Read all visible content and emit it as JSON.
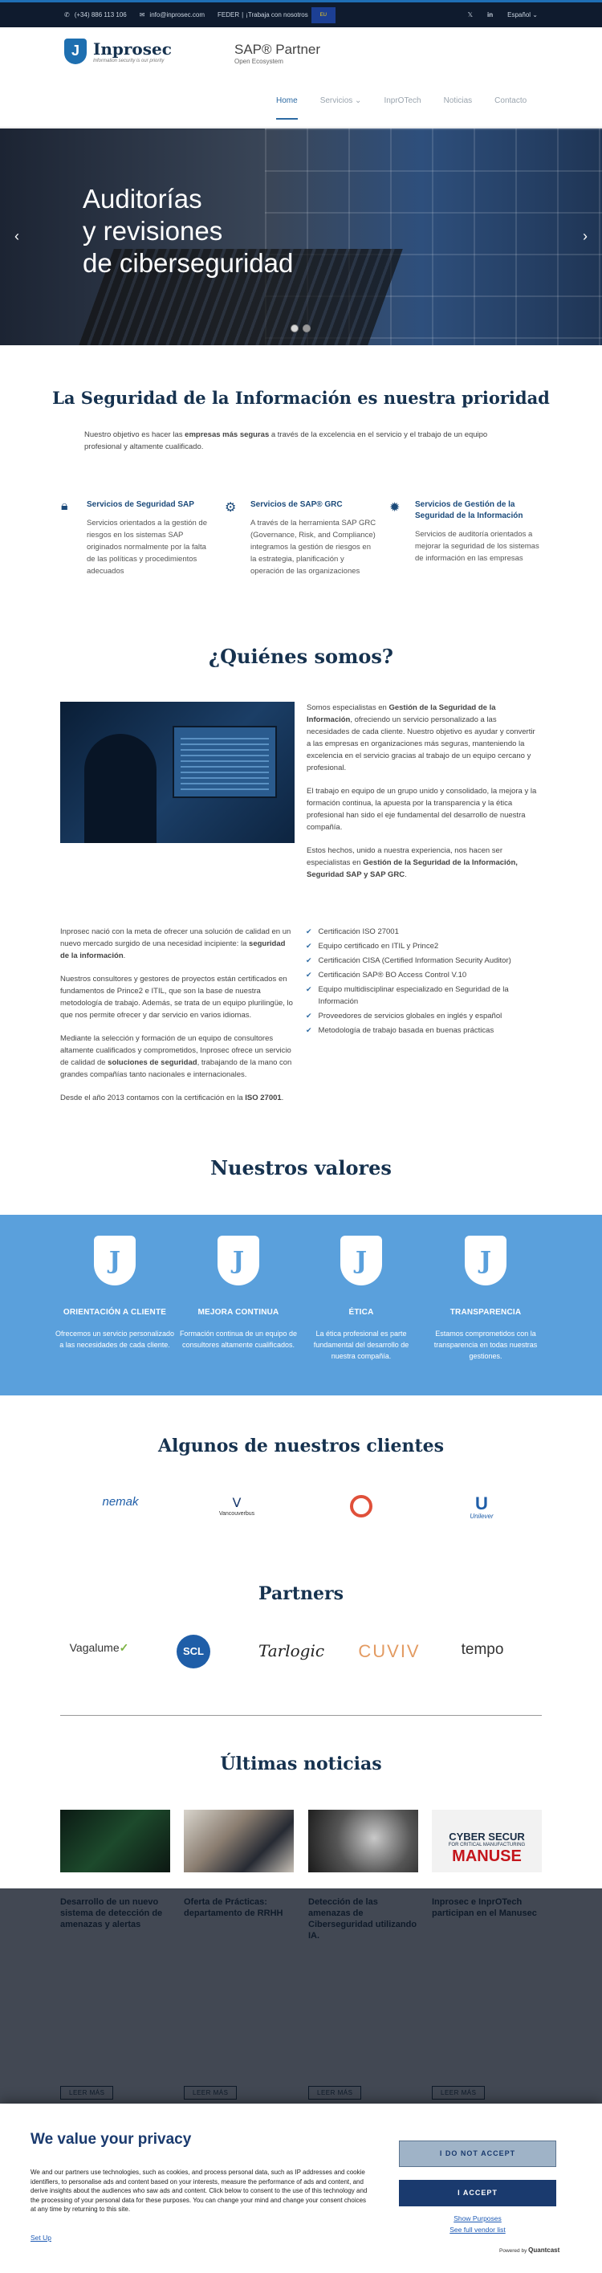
{
  "topbar": {
    "phone": "(+34) 886 113 106",
    "email": "info@inprosec.com",
    "feder": "FEDER",
    "jobs": "¡Trabaja con nosotros",
    "eu_label": "EU",
    "language": "Español",
    "twitter": "𝕏",
    "linkedin": "in"
  },
  "brand": {
    "name": "Inprosec",
    "tagline": "Information security is our priority",
    "shield": "J"
  },
  "sap": {
    "title": "SAP® Partner",
    "subtitle": "Open Ecosystem"
  },
  "nav": [
    "Home",
    "Servicios",
    "InprOTech",
    "Noticias",
    "Contacto"
  ],
  "nav_servicios_arrow": "⌄",
  "hero": {
    "line1": "Auditorías",
    "line2": "y revisiones",
    "line3": "de ciberseguridad",
    "prev": "‹",
    "next": "›"
  },
  "priority": {
    "title": "La Seguridad de la Información es nuestra prioridad",
    "intro_a": "Nuestro objetivo es hacer las ",
    "intro_b": "empresas más seguras",
    "intro_c": " a través de la excelencia en el servicio y el trabajo de un equipo profesional y altamente cualificado."
  },
  "services": [
    {
      "title": "Servicios de Seguridad SAP",
      "text": "Servicios orientados a la gestión de riesgos en los sistemas SAP originados normalmente por la falta de las políticas y procedimientos adecuados",
      "icon": "lock-icon"
    },
    {
      "title": "Servicios de SAP® GRC",
      "text": "A través de la herramienta SAP GRC (Governance, Risk, and Compliance) integramos la gestión de riesgos en la estrategia, planificación y operación de las organizaciones",
      "icon": "gears-icon"
    },
    {
      "title": "Servicios de Gestión de la Seguridad de la Información",
      "text": "Servicios de auditoría orientados a mejorar la seguridad de los sistemas de información en las empresas",
      "icon": "badge-icon"
    }
  ],
  "about": {
    "title": "¿Quiénes somos?",
    "p1_a": "Somos especialistas en ",
    "p1_b": "Gestión de la Seguridad de la Información",
    "p1_c": ", ofreciendo un servicio personalizado a las necesidades de cada cliente. Nuestro objetivo es ayudar y convertir a las empresas en organizaciones más seguras, manteniendo la excelencia en el servicio gracias al trabajo de un equipo cercano y profesional.",
    "p2": "El trabajo en equipo de un grupo unido y consolidado, la mejora y la formación continua, la apuesta por la transparencia y la ética profesional han sido el eje fundamental del desarrollo de nuestra compañía.",
    "p3_a": "Estos hechos, unido a nuestra experiencia, nos hacen ser especialistas en ",
    "p3_b": "Gestión de la Seguridad de la Información, Seguridad SAP y SAP GRC",
    "p3_c": ".",
    "left1_a": "Inprosec nació con la meta de ofrecer una solución de calidad en un nuevo mercado surgido de una necesidad incipiente: la ",
    "left1_b": "seguridad de la información",
    "left1_c": ".",
    "left2": "Nuestros consultores y gestores de proyectos están certificados en fundamentos de Prince2 e ITIL, que son la base de nuestra metodología de trabajo. Además, se trata de un equipo plurilingüe, lo que nos permite ofrecer y dar servicio en varios idiomas.",
    "left3_a": "Mediante la selección y formación de un equipo de consultores altamente cualificados y comprometidos, Inprosec ofrece un servicio de calidad de ",
    "left3_b": "soluciones de seguridad",
    "left3_c": ", trabajando de la mano con grandes compañías tanto nacionales e internacionales.",
    "left4_a": "Desde el año 2013 contamos con la certificación en la ",
    "left4_b": "ISO 27001",
    "left4_c": ".",
    "check": "✔",
    "checks": [
      "Certificación ISO 27001",
      "Equipo certificado en ITIL y Prince2",
      "Certificación CISA (Certified Information Security Auditor)",
      "Certificación SAP® BO Access Control V.10",
      "Equipo multidisciplinar especializado en Seguridad de la Información",
      "Proveedores de servicios globales en inglés y español",
      "Metodología de trabajo basada en buenas prácticas"
    ]
  },
  "values": {
    "title": "Nuestros valores",
    "shield": "J",
    "items": [
      {
        "title": "ORIENTACIÓN A CLIENTE",
        "text": "Ofrecemos un servicio personalizado a las necesidades de cada cliente."
      },
      {
        "title": "MEJORA CONTINUA",
        "text": "Formación continua de un equipo de consultores altamente cualificados."
      },
      {
        "title": "ÉTICA",
        "text": "La ética profesional es parte fundamental del desarrollo de nuestra compañía."
      },
      {
        "title": "TRANSPARENCIA",
        "text": "Estamos comprometidos con la transparencia en todas nuestras gestiones."
      }
    ]
  },
  "clients": {
    "title": "Algunos de nuestros clientes",
    "items": [
      "nemak",
      "Vancouverbus",
      "",
      "Unilever"
    ]
  },
  "partners": {
    "title": "Partners",
    "items": [
      "Vagalume",
      "SCL",
      "Tarlogic",
      "CUVIV",
      "tempo"
    ]
  },
  "news": {
    "title": "Últimas noticias",
    "more": "LEER MÁS",
    "items": [
      {
        "title": "Desarrollo de un nuevo sistema de detección de amenazas y alertas"
      },
      {
        "title": "Oferta de Prácticas: departamento de RRHH"
      },
      {
        "title": "Detección de las amenazas de Ciberseguridad utilizando IA."
      },
      {
        "title": "Inprosec e InprOTech participan en el Manusec"
      }
    ],
    "manusec_1": "CYBER SECUR",
    "manusec_2": "FOR CRITICAL MANUFACTURING",
    "manusec_3": "MANUSE"
  },
  "consent": {
    "title": "We value your privacy",
    "body": "We and our partners use technologies, such as cookies, and process personal data, such as IP addresses and cookie identifiers, to personalise ads and content based on your interests, measure the performance of ads and content, and derive insights about the audiences who saw ads and content. Click below to consent to the use of this technology and the processing of your personal data for these purposes. You can change your mind and change your consent choices at any time by returning to this site.",
    "setup": "Set Up",
    "decline": "I DO NOT ACCEPT",
    "accept": "I ACCEPT",
    "purposes": "Show Purposes",
    "vendors": "See full vendor list",
    "powered": "Powered by",
    "brand": "Quantcast"
  }
}
